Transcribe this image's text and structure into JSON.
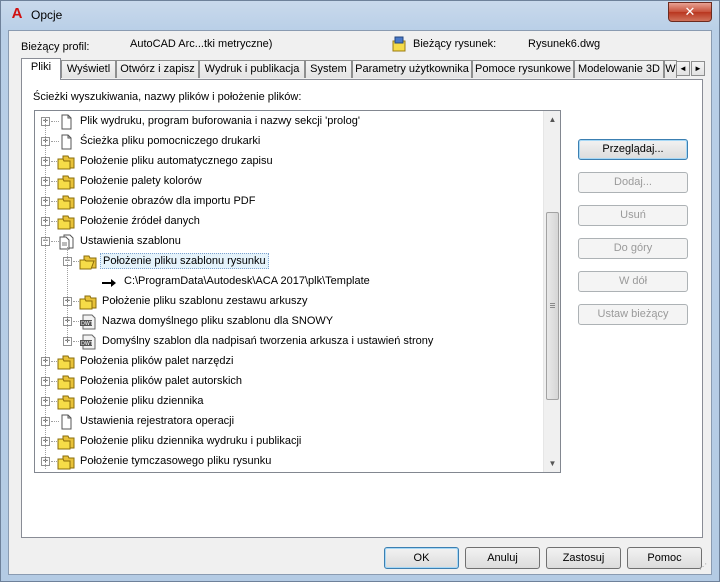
{
  "window": {
    "title": "Opcje",
    "app_icon": "A",
    "close_glyph": "✕"
  },
  "header": {
    "profile_label": "Bieżący profil:",
    "profile_value": "AutoCAD Arc...tki metryczne)",
    "drawing_label": "Bieżący rysunek:",
    "drawing_value": "Rysunek6.dwg"
  },
  "tabs": [
    {
      "label": "Pliki",
      "active": true
    },
    {
      "label": "Wyświetl"
    },
    {
      "label": "Otwórz i zapisz"
    },
    {
      "label": "Wydruk i publikacja"
    },
    {
      "label": "System"
    },
    {
      "label": "Parametry użytkownika"
    },
    {
      "label": "Pomoce rysunkowe"
    },
    {
      "label": "Modelowanie 3D"
    },
    {
      "label": "W"
    }
  ],
  "tab_scroll": {
    "left": "◄",
    "right": "►"
  },
  "panel": {
    "paths_label": "Ścieżki wyszukiwania, nazwy plików i położenie plików:"
  },
  "tree": [
    {
      "label": "Plik wydruku, program buforowania i nazwy sekcji 'prolog'",
      "level": 0,
      "icon": "document-icon",
      "expander": "+"
    },
    {
      "label": "Ścieżka pliku pomocniczego drukarki",
      "level": 0,
      "icon": "document-icon",
      "expander": "+"
    },
    {
      "label": "Położenie pliku automatycznego zapisu",
      "level": 0,
      "icon": "folder-icon",
      "expander": "+"
    },
    {
      "label": "Położenie palety kolorów",
      "level": 0,
      "icon": "folder-icon",
      "expander": "+"
    },
    {
      "label": "Położenie obrazów dla importu PDF",
      "level": 0,
      "icon": "folder-icon",
      "expander": "+"
    },
    {
      "label": "Położenie źródeł danych",
      "level": 0,
      "icon": "folder-icon",
      "expander": "+"
    },
    {
      "label": "Ustawienia szablonu",
      "level": 0,
      "icon": "documents-icon",
      "expander": "−"
    },
    {
      "label": "Położenie pliku szablonu rysunku",
      "level": 1,
      "icon": "open-folder-icon",
      "expander": "−",
      "selected": true
    },
    {
      "label": "C:\\ProgramData\\Autodesk\\ACA 2017\\plk\\Template",
      "level": 2,
      "icon": "arrow-icon"
    },
    {
      "label": "Położenie pliku szablonu zestawu arkuszy",
      "level": 1,
      "icon": "folder-icon",
      "expander": "+"
    },
    {
      "label": "Nazwa domyślnego pliku szablonu dla SNOWY",
      "level": 1,
      "icon": "dwt-icon",
      "expander": "+"
    },
    {
      "label": "Domyślny szablon dla nadpisań tworzenia arkusza i ustawień strony",
      "level": 1,
      "icon": "dwt-icon",
      "expander": "+"
    },
    {
      "label": "Położenia plików palet narzędzi",
      "level": 0,
      "icon": "folder-icon",
      "expander": "+"
    },
    {
      "label": "Położenia plików palet autorskich",
      "level": 0,
      "icon": "folder-icon",
      "expander": "+"
    },
    {
      "label": "Położenie pliku dziennika",
      "level": 0,
      "icon": "folder-icon",
      "expander": "+"
    },
    {
      "label": "Ustawienia rejestratora operacji",
      "level": 0,
      "icon": "document-icon",
      "expander": "+"
    },
    {
      "label": "Położenie pliku dziennika wydruku i publikacji",
      "level": 0,
      "icon": "folder-icon",
      "expander": "+"
    },
    {
      "label": "Położenie tymczasowego pliku rysunku",
      "level": 0,
      "icon": "folder-icon",
      "expander": "+"
    }
  ],
  "scrollbar": {
    "up": "▲",
    "down": "▼"
  },
  "side_buttons": [
    {
      "label": "Przeglądaj...",
      "enabled": true,
      "name": "browse-button"
    },
    {
      "label": "Dodaj...",
      "enabled": false,
      "name": "add-button"
    },
    {
      "label": "Usuń",
      "enabled": false,
      "name": "remove-button"
    },
    {
      "label": "Do góry",
      "enabled": false,
      "name": "move-up-button"
    },
    {
      "label": "W dół",
      "enabled": false,
      "name": "move-down-button"
    },
    {
      "label": "Ustaw bieżący",
      "enabled": false,
      "name": "set-current-button"
    }
  ],
  "bottom_buttons": [
    {
      "label": "OK",
      "name": "ok-button"
    },
    {
      "label": "Anuluj",
      "name": "cancel-button"
    },
    {
      "label": "Zastosuj",
      "name": "apply-button"
    },
    {
      "label": "Pomoc",
      "name": "help-button"
    }
  ],
  "colors": {
    "selection": "#e5f3fb",
    "folder": "#f6dc48",
    "close": "#c7513a"
  }
}
